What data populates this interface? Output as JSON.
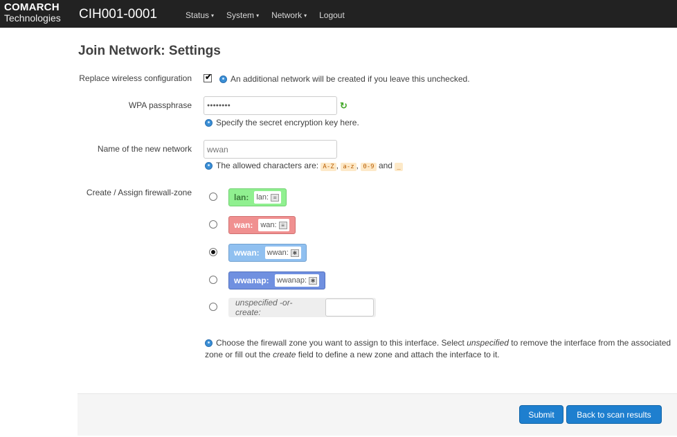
{
  "brand": {
    "line1": "COMARCH",
    "line2": "Technologies"
  },
  "header": {
    "hostname": "CIH001-0001",
    "menu": [
      {
        "label": "Status",
        "caret": "▾"
      },
      {
        "label": "System",
        "caret": "▾"
      },
      {
        "label": "Network",
        "caret": "▾"
      },
      {
        "label": "Logout"
      }
    ]
  },
  "page": {
    "title": "Join Network: Settings"
  },
  "form": {
    "replace": {
      "label": "Replace wireless configuration",
      "checked": true,
      "tick": "✔",
      "help": "An additional network will be created if you leave this unchecked."
    },
    "wpa": {
      "label": "WPA passphrase",
      "value": "●●●●●●●●",
      "refresh_icon": "↻",
      "help": "Specify the secret encryption key here."
    },
    "name": {
      "label": "Name of the new network",
      "value": "wwan",
      "help_prefix": "The allowed characters are:",
      "chars": [
        "A-Z",
        "a-z",
        "0-9",
        "_"
      ],
      "sep1": ",",
      "sep2": ",",
      "and": "and"
    },
    "zone": {
      "label": "Create / Assign firewall-zone",
      "options": [
        {
          "name": "lan:",
          "badge": "lan:",
          "icon": "network-icon",
          "color": "#90f090",
          "selected": false
        },
        {
          "name": "wan:",
          "badge": "wan:",
          "icon": "ethernet-icon",
          "color": "#f09090",
          "selected": false
        },
        {
          "name": "wwan:",
          "badge": "wwan:",
          "icon": "wireless-icon",
          "color": "#90c0f0",
          "selected": true
        },
        {
          "name": "wwanap:",
          "badge": "wwanap:",
          "icon": "wireless-icon",
          "color": "#7090e0",
          "selected": false
        }
      ],
      "create_label": "unspecified -or- create:",
      "create_value": "",
      "help_1": "Choose the firewall zone you want to assign to this interface. Select ",
      "help_em1": "unspecified",
      "help_2": " to remove the interface from the associated zone or fill out the ",
      "help_em2": "create",
      "help_3": " field to define a new zone and attach the interface to it."
    }
  },
  "buttons": {
    "submit": "Submit",
    "back": "Back to scan results"
  },
  "colors": {
    "navbar": "#222222",
    "primary": "#1e7fcf"
  }
}
